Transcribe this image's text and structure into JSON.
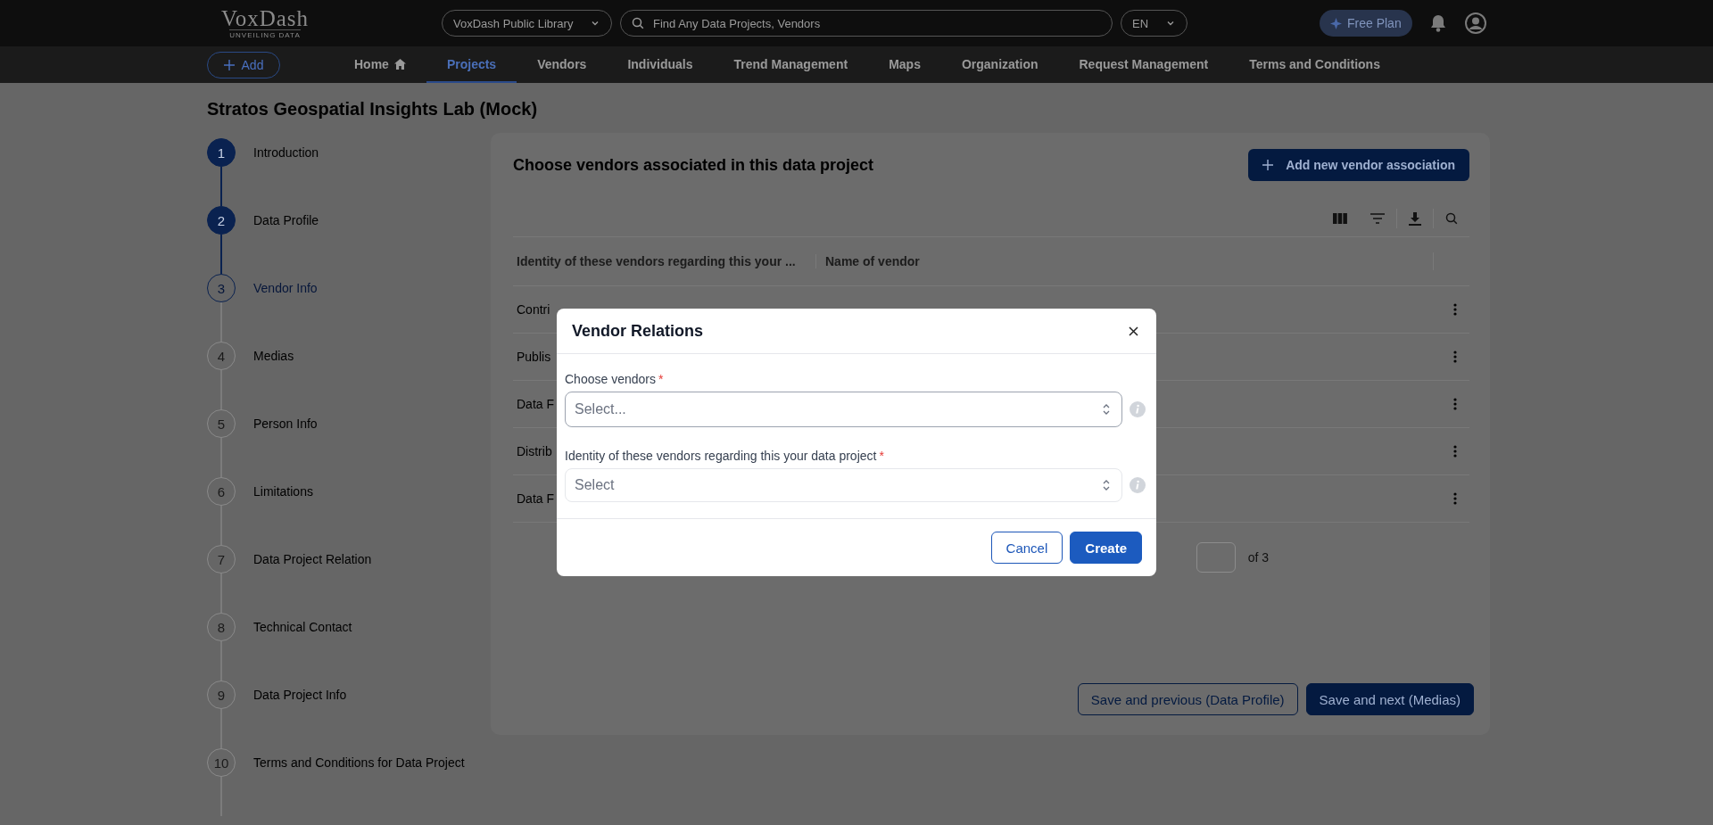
{
  "header": {
    "logo": {
      "name": "VoxDash",
      "tagline": "UNVEILING DATA"
    },
    "library_select": {
      "value": "VoxDash Public Library"
    },
    "search": {
      "placeholder": "Find Any Data Projects, Vendors"
    },
    "language_select": {
      "value": "EN"
    },
    "plan_button": "Free Plan"
  },
  "nav": {
    "add_button": "Add",
    "items": [
      {
        "label": "Home",
        "kind": "home",
        "selected": false
      },
      {
        "label": "Projects",
        "kind": "plain",
        "selected": true
      },
      {
        "label": "Vendors",
        "kind": "plain",
        "selected": false
      },
      {
        "label": "Individuals",
        "kind": "plain",
        "selected": false
      },
      {
        "label": "Trend Management",
        "kind": "plain",
        "selected": false
      },
      {
        "label": "Maps",
        "kind": "plain",
        "selected": false
      },
      {
        "label": "Organization",
        "kind": "plain",
        "selected": false
      },
      {
        "label": "Request Management",
        "kind": "plain",
        "selected": false
      },
      {
        "label": "Terms and Conditions",
        "kind": "plain",
        "selected": false
      }
    ]
  },
  "page_title": "Stratos Geospatial Insights Lab (Mock)",
  "steps": [
    {
      "number": "1",
      "label": "Introduction",
      "completed": true,
      "selected": false
    },
    {
      "number": "2",
      "label": "Data Profile",
      "completed": true,
      "selected": false
    },
    {
      "number": "3",
      "label": "Vendor Info",
      "completed": false,
      "selected": true
    },
    {
      "number": "4",
      "label": "Medias",
      "completed": false,
      "selected": false
    },
    {
      "number": "5",
      "label": "Person Info",
      "completed": false,
      "selected": false
    },
    {
      "number": "6",
      "label": "Limitations",
      "completed": false,
      "selected": false
    },
    {
      "number": "7",
      "label": "Data Project Relation",
      "completed": false,
      "selected": false
    },
    {
      "number": "8",
      "label": "Technical Contact",
      "completed": false,
      "selected": false
    },
    {
      "number": "9",
      "label": "Data Project Info",
      "completed": false,
      "selected": false
    },
    {
      "number": "10",
      "label": "Terms and Conditions for Data Project",
      "completed": false,
      "selected": false
    }
  ],
  "card": {
    "heading": "Choose vendors associated in this data project",
    "add_button": "Add new vendor association",
    "table": {
      "columns": [
        "Identity of these vendors regarding this your ...",
        "Name of vendor"
      ],
      "rows": [
        {
          "column_1": "Contri"
        },
        {
          "column_1": "Publis"
        },
        {
          "column_1": "Data F"
        },
        {
          "column_1": "Distrib"
        },
        {
          "column_1": "Data F"
        }
      ]
    },
    "pagination": {
      "total": "of 3"
    },
    "previous_button": "Save and previous (Data Profile)",
    "next_button": "Save and next (Medias)"
  },
  "modal": {
    "title": "Vendor Relations",
    "fields": [
      {
        "label": "Choose vendors",
        "required_mark": "*",
        "placeholder": "Select...",
        "focused": true
      },
      {
        "label": "Identity of these vendors regarding this your data project",
        "required_mark": "*",
        "placeholder": "Select",
        "focused": false
      }
    ],
    "cancel_button": "Cancel",
    "create_button": "Create"
  }
}
